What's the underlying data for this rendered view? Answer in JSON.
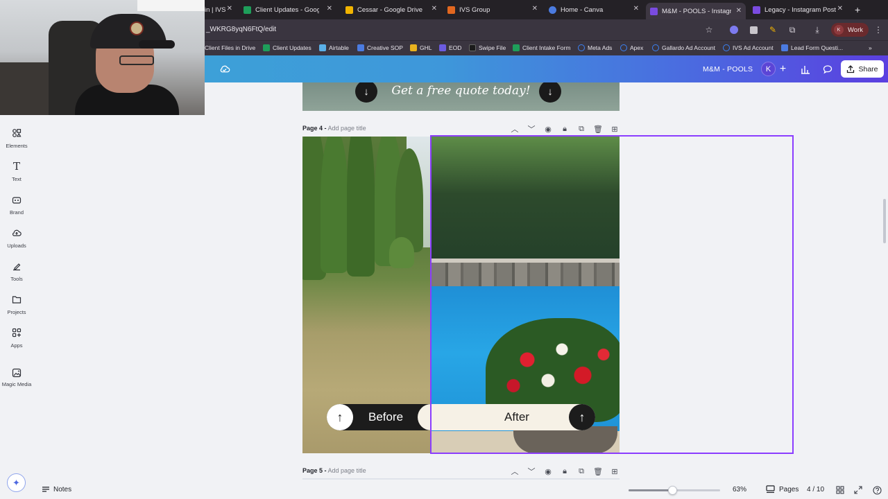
{
  "browser": {
    "tabs": [
      {
        "title": "in | IVS",
        "color": "#6a6a6a"
      },
      {
        "title": "Client Updates - Google S",
        "color": "#1e9e5a"
      },
      {
        "title": "Cessar - Google Drive",
        "color": "#f2b400"
      },
      {
        "title": "IVS Group",
        "color": "#e2671f"
      },
      {
        "title": "Home - Canva",
        "color": "#4b7be0"
      },
      {
        "title": "M&M - POOLS - Instagram",
        "color": "#7a4be0",
        "active": true
      },
      {
        "title": "Legacy - Instagram Post",
        "color": "#7a4be0"
      }
    ],
    "new_tab": "+",
    "url": "_WKRG8yqN6FtQ/edit",
    "profile": {
      "initial": "K",
      "label": "Work"
    },
    "bookmarks": [
      {
        "label": "Client Files in Drive",
        "color": "#f2b400"
      },
      {
        "label": "Client Updates",
        "color": "#1e9e5a"
      },
      {
        "label": "Airtable",
        "color": "#5ab0e8"
      },
      {
        "label": "Creative SOP",
        "color": "#4b7be0"
      },
      {
        "label": "GHL",
        "color": "#e8b21e"
      },
      {
        "label": "EOD",
        "color": "#6b5be0"
      },
      {
        "label": "Swipe File",
        "color": "#1b1b1b"
      },
      {
        "label": "Client Intake Form",
        "color": "#1e9e5a"
      },
      {
        "label": "Meta Ads",
        "color": "#3b82f6"
      },
      {
        "label": "Apex",
        "color": "#3b82f6"
      },
      {
        "label": "Gallardo Ad Account",
        "color": "#3b82f6"
      },
      {
        "label": "IVS Ad Account",
        "color": "#3b82f6"
      },
      {
        "label": "Lead Form Questi...",
        "color": "#4b7be0"
      }
    ],
    "bookmarks_more": "»"
  },
  "canva": {
    "design_title": "M&M - POOLS",
    "user_initial": "K",
    "share_label": "Share",
    "add_label": "+"
  },
  "rail": [
    {
      "label": "Elements",
      "icon": "elements-icon"
    },
    {
      "label": "Text",
      "icon": "text-icon"
    },
    {
      "label": "Brand",
      "icon": "brand-icon"
    },
    {
      "label": "Uploads",
      "icon": "uploads-icon"
    },
    {
      "label": "Tools",
      "icon": "tools-icon"
    },
    {
      "label": "Projects",
      "icon": "projects-icon"
    },
    {
      "label": "Apps",
      "icon": "apps-icon"
    },
    {
      "label": "Magic Media",
      "icon": "magic-media-icon"
    }
  ],
  "canvas": {
    "prev_page_cta": "Get a free quote today!",
    "page4": {
      "label": "Page 4 -",
      "add_title": "Add page title"
    },
    "page5": {
      "label": "Page 5 -",
      "add_title": "Add page title"
    },
    "before_label": "Before",
    "after_label": "After"
  },
  "bottom": {
    "notes_label": "Notes",
    "zoom": "63%",
    "zoom_level": 0.48,
    "pages_label": "Pages",
    "page_count": "4 / 10"
  }
}
